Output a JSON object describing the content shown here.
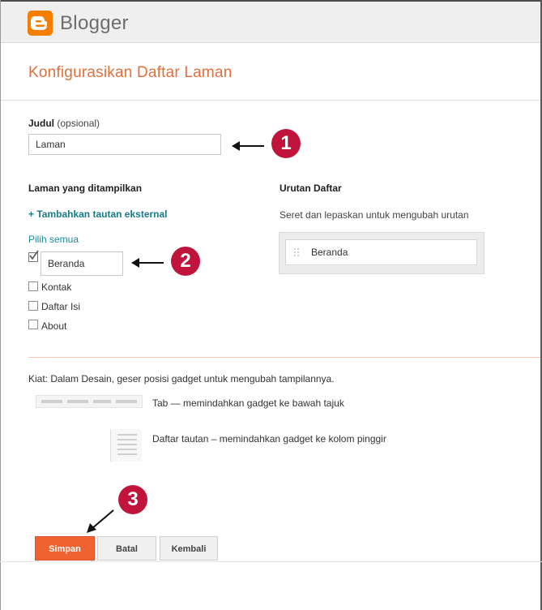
{
  "app": {
    "brand": "Blogger",
    "brand_color": "#f57d00"
  },
  "dialog": {
    "title": "Konfigurasikan Daftar Laman"
  },
  "title_field": {
    "label": "Judul",
    "hint": "(opsional)",
    "value": "Laman"
  },
  "pages": {
    "heading": "Laman yang ditampilkan",
    "add_external": "+ Tambahkan tautan eksternal",
    "select_all": "Pilih semua",
    "items": [
      {
        "label": "Beranda",
        "checked": true
      },
      {
        "label": "Kontak",
        "checked": false
      },
      {
        "label": "Daftar Isi",
        "checked": false
      },
      {
        "label": "About",
        "checked": false
      }
    ]
  },
  "order": {
    "heading": "Urutan Daftar",
    "hint": "Seret dan lepaskan untuk mengubah urutan",
    "items": [
      "Beranda"
    ]
  },
  "tips": {
    "intro": "Kiat: Dalam Desain, geser posisi gadget untuk mengubah tampilannya.",
    "tab_desc": "Tab — memindahkan gadget ke bawah tajuk",
    "list_desc": "Daftar tautan – memindahkan gadget ke kolom pinggir"
  },
  "buttons": {
    "save": "Simpan",
    "cancel": "Batal",
    "back": "Kembali"
  },
  "annotations": {
    "badge_1": "1",
    "badge_2": "2",
    "badge_3": "3",
    "badge_color": "#c0143c"
  },
  "colors": {
    "accent_title": "#e36f3c",
    "save_button": "#f0622f",
    "link": "#1a7a8a"
  }
}
